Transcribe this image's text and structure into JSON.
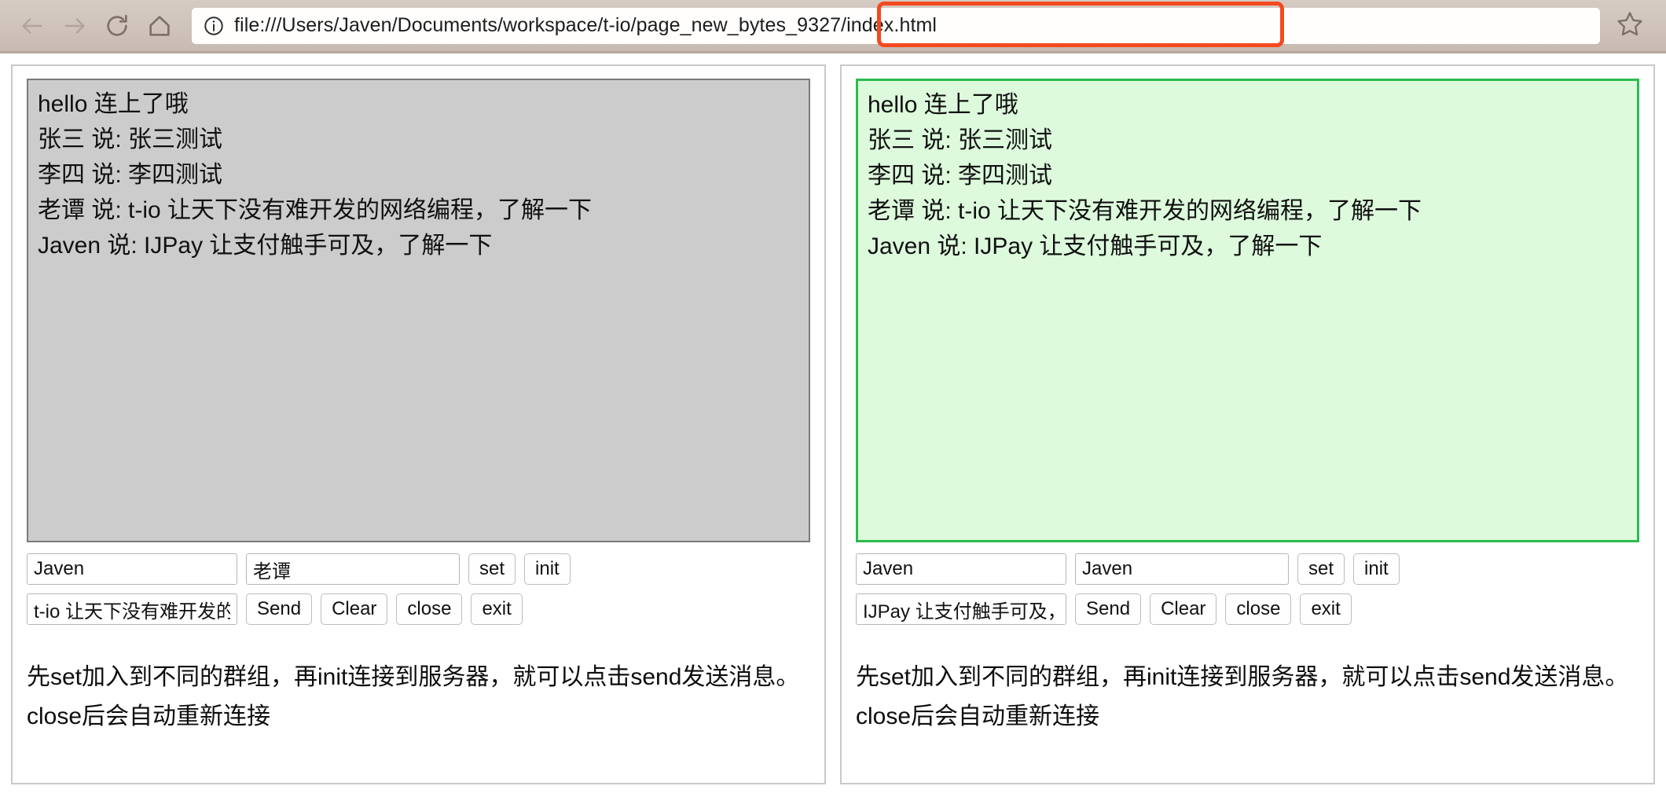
{
  "browser": {
    "back_icon": "back-arrow-icon",
    "forward_icon": "forward-arrow-icon",
    "reload_icon": "reload-icon",
    "home_icon": "home-icon",
    "info_icon": "info-circle-icon",
    "star_icon": "star-bookmark-icon",
    "url_prefix": "file:///Users/Javen/Documents/workspace/t-io",
    "url_highlighted": "/page_new_bytes_9327/index.html",
    "url_full": "file:///Users/Javen/Documents/workspace/t-io/page_new_bytes_9327/index.html",
    "annotation_color": "#f4491f"
  },
  "panels": [
    {
      "id": "left",
      "chat_background": "#cccccc",
      "chat_border": "#7b7b7b",
      "messages": [
        "hello 连上了哦",
        "张三 说: 张三测试",
        "李四 说: 李四测试",
        "老谭 说: t-io 让天下没有难开发的网络编程，了解一下",
        "Javen 说: IJPay 让支付触手可及，了解一下"
      ],
      "name_input": {
        "value": "Javen",
        "placeholder": ""
      },
      "group_input": {
        "value": "老谭",
        "placeholder": ""
      },
      "message_input": {
        "value": "t-io 让天下没有难开发的网络编程，了解一下",
        "placeholder": ""
      },
      "set_label": "set",
      "init_label": "init",
      "send_label": "Send",
      "clear_label": "Clear",
      "close_label": "close",
      "exit_label": "exit",
      "hint": "先set加入到不同的群组，再init连接到服务器，就可以点击send发送消息。close后会自动重新连接"
    },
    {
      "id": "right",
      "chat_background": "#ddfadd",
      "chat_border": "#2bbb4e",
      "messages": [
        "hello 连上了哦",
        "张三 说: 张三测试",
        "李四 说: 李四测试",
        "老谭 说: t-io 让天下没有难开发的网络编程，了解一下",
        "Javen 说: IJPay 让支付触手可及，了解一下"
      ],
      "name_input": {
        "value": "Javen",
        "placeholder": ""
      },
      "group_input": {
        "value": "Javen",
        "placeholder": ""
      },
      "message_input": {
        "value": "IJPay 让支付触手可及，了解一下",
        "placeholder": ""
      },
      "set_label": "set",
      "init_label": "init",
      "send_label": "Send",
      "clear_label": "Clear",
      "close_label": "close",
      "exit_label": "exit",
      "hint": "先set加入到不同的群组，再init连接到服务器，就可以点击send发送消息。close后会自动重新连接"
    }
  ]
}
